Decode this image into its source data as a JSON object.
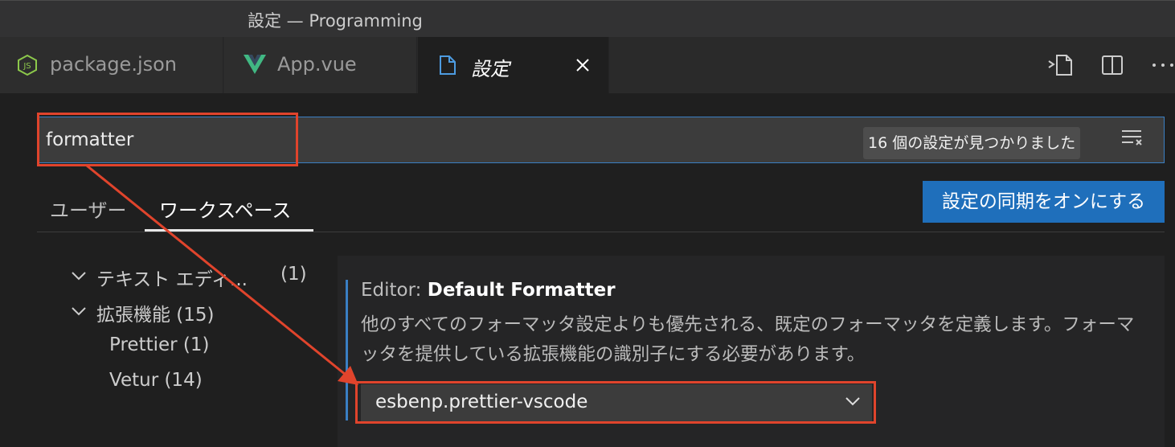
{
  "window": {
    "title": "設定 — Programming"
  },
  "tabs": [
    {
      "label": "package.json",
      "icon": "nodejs-icon"
    },
    {
      "label": "App.vue",
      "icon": "vue-icon"
    },
    {
      "label": "設定",
      "icon": "file-icon",
      "active": true
    }
  ],
  "editor_actions": [
    "open-settings-json-icon",
    "split-editor-icon",
    "more-actions-icon"
  ],
  "search": {
    "value": "formatter",
    "result_count": "16 個の設定が見つかりました"
  },
  "scope_tabs": [
    {
      "label": "ユーザー"
    },
    {
      "label": "ワークスペース",
      "active": true
    }
  ],
  "sync_button": "設定の同期をオンにする",
  "toc": [
    {
      "label": "テキスト エディ...",
      "count": "(1)"
    },
    {
      "label": "拡張機能 (15)"
    },
    {
      "label": "Prettier (1)"
    },
    {
      "label": "Vetur (14)"
    }
  ],
  "setting": {
    "category": "Editor: ",
    "name": "Default Formatter",
    "description": "他のすべてのフォーマッタ設定よりも優先される、既定のフォーマッタを定義します。フォーマッタを提供している拡張機能の識別子にする必要があります。",
    "value": "esbenp.prettier-vscode"
  },
  "colors": {
    "highlight": "#e0442c",
    "accent": "#3a7fc4",
    "button": "#1f6fbb"
  }
}
